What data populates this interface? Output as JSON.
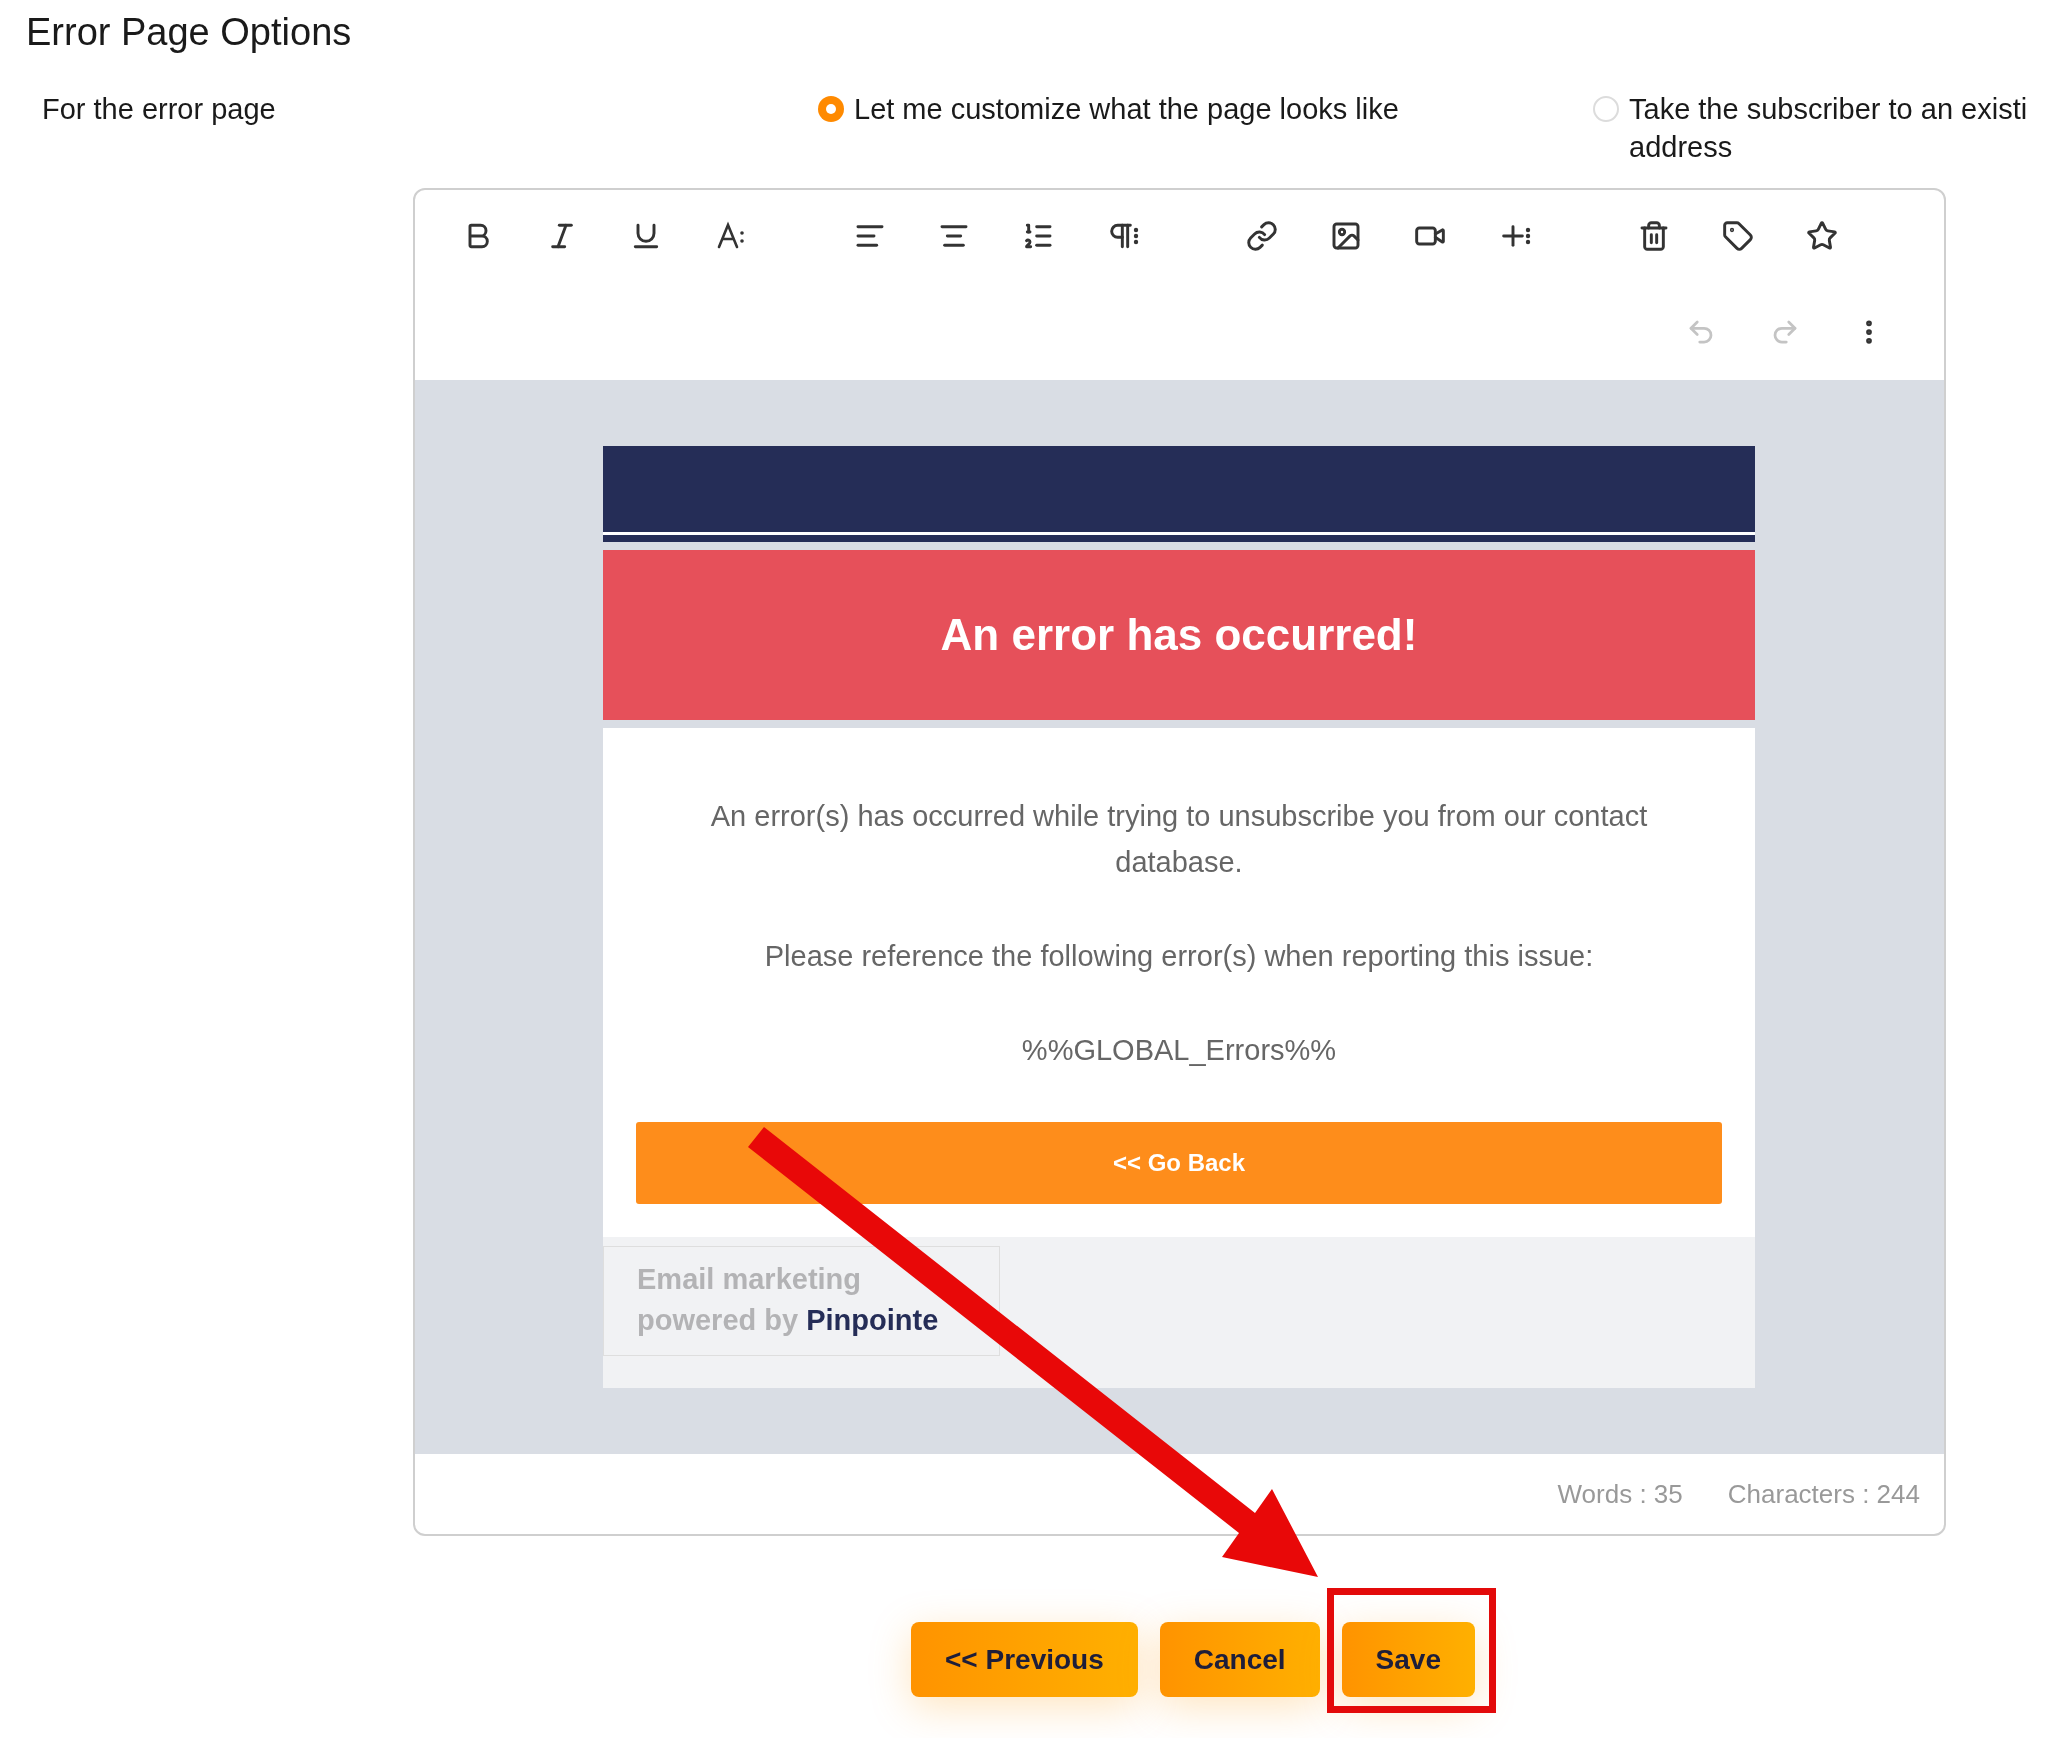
{
  "page": {
    "title": "Error Page Options"
  },
  "option_row": {
    "label": "For the error page",
    "choices": [
      {
        "lines": [
          "Let me customize what the page looks like"
        ],
        "selected": true
      },
      {
        "lines": [
          "Take the subscriber to an existi",
          "address"
        ],
        "selected": false
      }
    ]
  },
  "editor": {
    "history": [
      {
        "kind": "undo",
        "disabled": true
      },
      {
        "kind": "redo",
        "disabled": true
      }
    ],
    "email": {
      "heading": "An error has occurred!",
      "paragraphs": [
        "An error(s) has occurred while trying to unsubscribe you from our contact database.",
        "Please reference the following error(s) when reporting this issue:",
        "%%GLOBAL_Errors%%"
      ],
      "button": "<< Go Back",
      "footer": {
        "line_1": "Email marketing",
        "prefix": "powered by",
        "brand": "Pinpointe"
      }
    },
    "counts": [
      "Words : 35",
      "Characters : 244"
    ]
  },
  "buttons": [
    {
      "label": "<< Previous",
      "highlighted": false
    },
    {
      "label": "Cancel",
      "highlighted": false
    },
    {
      "label": "Save",
      "highlighted": true
    }
  ]
}
